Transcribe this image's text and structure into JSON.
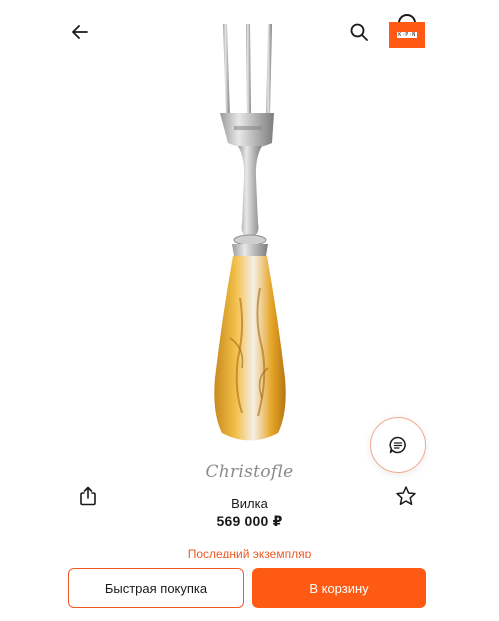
{
  "header": {
    "back_icon": "arrow-left-icon",
    "search_icon": "search-icon",
    "cart_icon": "shopping-bag-icon",
    "cart_badge_text": "K·P·N"
  },
  "product": {
    "image_icon": "fork-product-image",
    "brand": "Christofle",
    "name": "Вилка",
    "price": "569 000 ₽",
    "stock_note": "Последний экземпляр"
  },
  "actions": {
    "share_icon": "share-icon",
    "favorite_icon": "star-outline-icon",
    "chat_icon": "chat-bubble-icon",
    "quick_buy_label": "Быстрая покупка",
    "add_to_cart_label": "В корзину"
  },
  "colors": {
    "accent": "#ff5a14",
    "stock_text": "#ee5a24",
    "text": "#1a1a1a"
  }
}
